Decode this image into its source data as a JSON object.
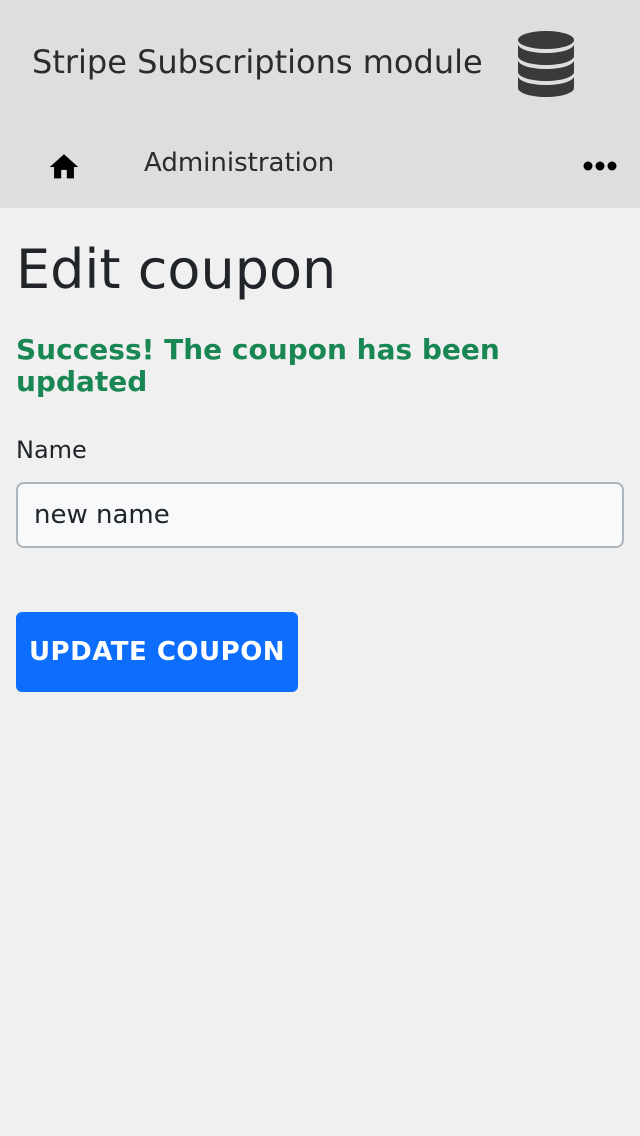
{
  "header": {
    "app_title": "Stripe Subscriptions module",
    "logo_icon": "database-icon"
  },
  "nav": {
    "home_icon": "home-icon",
    "administration_label": "Administration",
    "more_icon": "more-horizontal-icon"
  },
  "main": {
    "page_title": "Edit coupon",
    "success_message": "Success! The coupon has been updated",
    "name_label": "Name",
    "name_value": "new name",
    "update_button_label": "UPDATE COUPON"
  },
  "colors": {
    "header_bg": "#dedede",
    "page_bg": "#f0f0f0",
    "success_text": "#198754",
    "primary_button": "#0d6efd"
  }
}
